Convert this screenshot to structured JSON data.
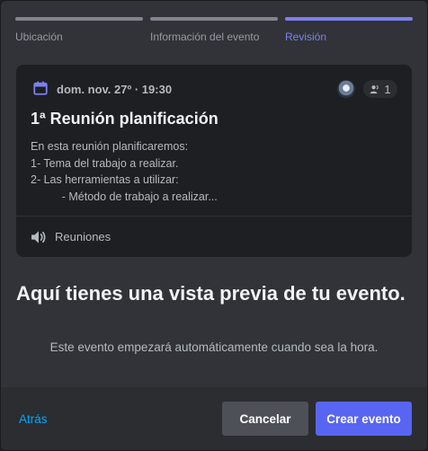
{
  "steps": [
    {
      "label": "Ubicación",
      "active": false
    },
    {
      "label": "Información del evento",
      "active": false
    },
    {
      "label": "Revisión",
      "active": true
    }
  ],
  "event": {
    "date": "dom. nov. 27º · 19:30",
    "attendee_count": "1",
    "title": "1ª Reunión planificación",
    "description_lines": [
      "En esta reunión planificaremos:",
      "1- Tema del trabajo a realizar.",
      "2- Las herramientas a utilizar:",
      "          - Método de trabajo a realizar..."
    ],
    "channel": "Reuniones"
  },
  "heading": "Aquí tienes una vista previa de tu evento.",
  "subtext": "Este evento empezará automáticamente cuando sea la hora.",
  "footer": {
    "back_label": "Atrás",
    "cancel_label": "Cancelar",
    "create_label": "Crear evento"
  },
  "icons": {
    "calendar": "calendar-icon",
    "users": "users-icon",
    "speaker": "speaker-icon"
  },
  "colors": {
    "accent": "#7c80ee",
    "primary_button": "#5865f2",
    "link": "#00a8fc"
  }
}
